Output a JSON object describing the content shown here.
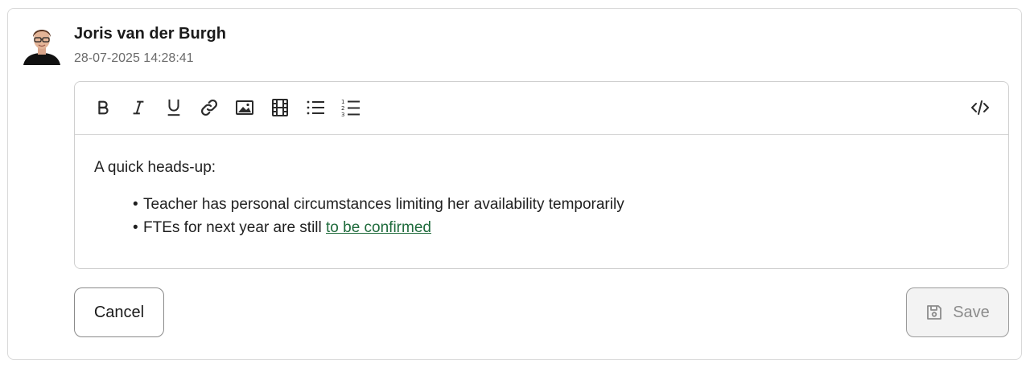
{
  "comment": {
    "author": "Joris van der Burgh",
    "timestamp": "28-07-2025 14:28:41"
  },
  "toolbar": {
    "buttons": [
      "bold",
      "italic",
      "underline",
      "link",
      "image",
      "video",
      "bullet-list",
      "numbered-list",
      "source-code"
    ]
  },
  "editor": {
    "intro": "A quick heads-up:",
    "bullets": [
      {
        "text": "Teacher has personal circumstances limiting her availability temporarily",
        "link": ""
      },
      {
        "text": "FTEs for next year are still ",
        "link": "to be confirmed"
      }
    ]
  },
  "actions": {
    "cancel_label": "Cancel",
    "save_label": "Save",
    "save_disabled": true
  },
  "colors": {
    "link": "#1f6b3c",
    "border": "#d9d9d9",
    "disabled_text": "#8c8c8c"
  }
}
